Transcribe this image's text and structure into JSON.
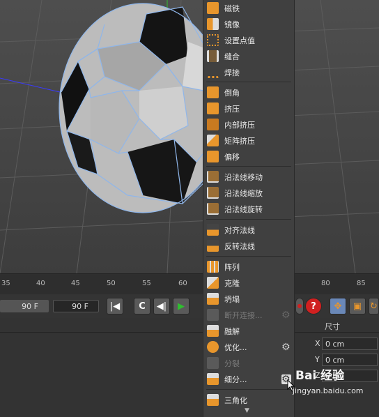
{
  "menu": {
    "items": [
      {
        "label": "磁铁",
        "icon": "magnet-icon",
        "disabled": false,
        "gear": false
      },
      {
        "label": "镜像",
        "icon": "mirror-icon",
        "disabled": false,
        "gear": false
      },
      {
        "label": "设置点值",
        "icon": "set-point-value-icon",
        "disabled": false,
        "gear": false
      },
      {
        "label": "缝合",
        "icon": "stitch-icon",
        "disabled": false,
        "gear": false
      },
      {
        "label": "焊接",
        "icon": "weld-icon",
        "disabled": false,
        "gear": false
      },
      {
        "label": "倒角",
        "icon": "bevel-icon",
        "disabled": false,
        "gear": false
      },
      {
        "label": "挤压",
        "icon": "extrude-icon",
        "disabled": false,
        "gear": false
      },
      {
        "label": "内部挤压",
        "icon": "extrude-inner-icon",
        "disabled": false,
        "gear": false
      },
      {
        "label": "矩阵挤压",
        "icon": "matrix-extrude-icon",
        "disabled": false,
        "gear": false
      },
      {
        "label": "偏移",
        "icon": "offset-icon",
        "disabled": false,
        "gear": false
      },
      {
        "label": "沿法线移动",
        "icon": "normal-move-icon",
        "disabled": false,
        "gear": false
      },
      {
        "label": "沿法线缩放",
        "icon": "normal-scale-icon",
        "disabled": false,
        "gear": false
      },
      {
        "label": "沿法线旋转",
        "icon": "normal-rotate-icon",
        "disabled": false,
        "gear": false
      },
      {
        "label": "对齐法线",
        "icon": "align-normals-icon",
        "disabled": false,
        "gear": false
      },
      {
        "label": "反转法线",
        "icon": "reverse-normals-icon",
        "disabled": false,
        "gear": false
      },
      {
        "label": "阵列",
        "icon": "array-icon",
        "disabled": false,
        "gear": false
      },
      {
        "label": "克隆",
        "icon": "clone-icon",
        "disabled": false,
        "gear": false
      },
      {
        "label": "坍塌",
        "icon": "collapse-icon",
        "disabled": false,
        "gear": false
      },
      {
        "label": "断开连接...",
        "icon": "disconnect-icon",
        "disabled": true,
        "gear": true
      },
      {
        "label": "融解",
        "icon": "melt-icon",
        "disabled": false,
        "gear": false
      },
      {
        "label": "优化...",
        "icon": "optimize-icon",
        "disabled": false,
        "gear": true
      },
      {
        "label": "分裂",
        "icon": "split-icon",
        "disabled": true,
        "gear": false
      },
      {
        "label": "细分...",
        "icon": "subdivide-icon",
        "disabled": false,
        "gear": true
      },
      {
        "label": "三角化",
        "icon": "triangulate-icon",
        "disabled": false,
        "gear": false
      }
    ],
    "more_arrow": "▼"
  },
  "ruler": {
    "ticks": [
      "35",
      "40",
      "45",
      "50",
      "55",
      "60",
      "80",
      "85"
    ]
  },
  "timeline": {
    "end_frame_a": "90 F",
    "end_frame_b": "90 F",
    "go_start": "|◀",
    "loop": "C",
    "prev_key": "◀|",
    "play": "▶",
    "record": "⏺",
    "help": "?",
    "move": "✥",
    "scale": "▣",
    "rotate": "↻"
  },
  "attributes": {
    "size_header": "尺寸",
    "x_label": "X",
    "y_label": "Y",
    "z_label": "Z",
    "x_value": "0 cm",
    "y_value": "0 cm",
    "z_value": "0 cm"
  },
  "watermark": {
    "brand": "Bai 经验",
    "url": "jingyan.baidu.com"
  },
  "colors": {
    "menu_bg": "#404040",
    "accent_orange": "#e8962c",
    "play_green": "#2fbf2f",
    "record_red": "#d02020",
    "wire_blue": "#8fb6ea"
  }
}
